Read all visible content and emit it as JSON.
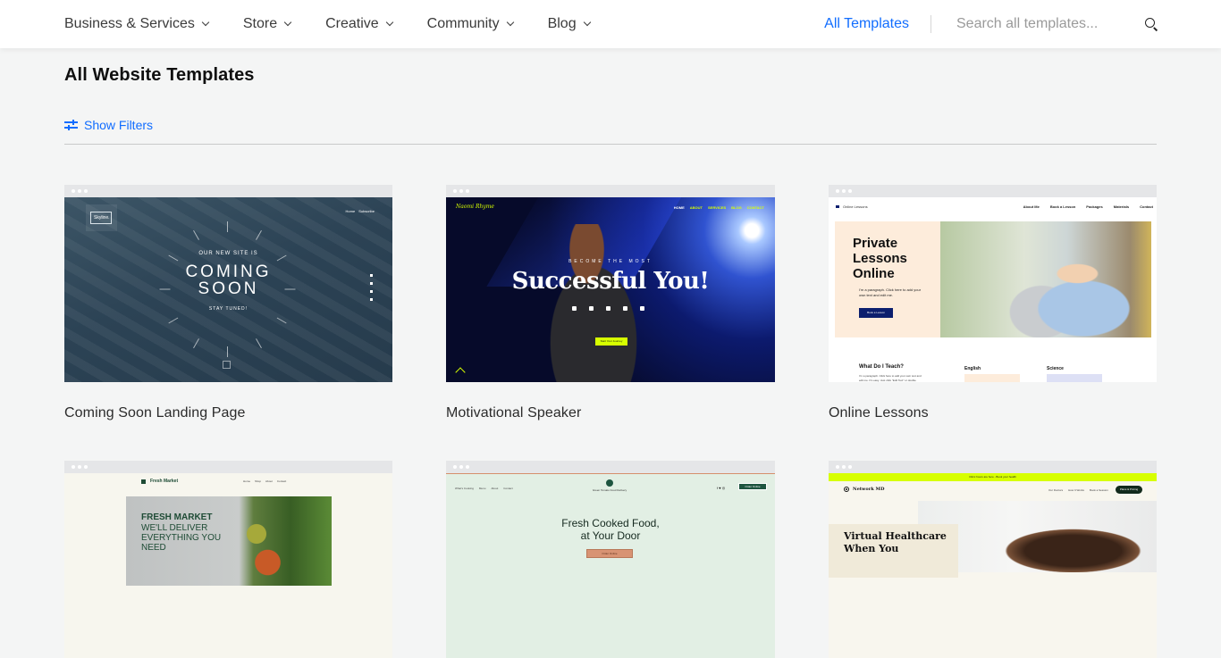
{
  "header": {
    "nav": [
      {
        "label": "Business & Services"
      },
      {
        "label": "Store"
      },
      {
        "label": "Creative"
      },
      {
        "label": "Community"
      },
      {
        "label": "Blog"
      }
    ],
    "all_templates": "All Templates",
    "search": {
      "placeholder": "Search all templates...",
      "value": ""
    },
    "accent_color": "#116dff"
  },
  "main": {
    "title": "All Website Templates",
    "filters_label": "Show Filters",
    "templates": [
      {
        "name": "Coming Soon Landing Page",
        "preview": {
          "brand": "Skyline.",
          "nav": [
            "Home",
            "Subscribe"
          ],
          "kicker": "OUR NEW SITE IS",
          "headline_1": "COMING",
          "headline_2": "SOON",
          "sub": "STAY TUNED!"
        }
      },
      {
        "name": "Motivational Speaker",
        "preview": {
          "brand": "Naomi Rhyme",
          "nav": [
            "HOME",
            "ABOUT",
            "SERVICES",
            "BLOG",
            "CONTACT"
          ],
          "kicker": "BECOME THE MOST",
          "headline": "Successful You!",
          "cta": "Start Your Journey"
        }
      },
      {
        "name": "Online Lessons",
        "preview": {
          "brand": "Online Lessons",
          "nav": [
            "About Me",
            "Book a Lesson",
            "Packages",
            "Materials",
            "Contact"
          ],
          "headline": "Private Lessons Online",
          "paragraph": "I'm a paragraph. Click here to add your own text and edit me.",
          "cta": "Book a Lesson",
          "section_title": "What Do I Teach?",
          "section_paragraph": "I'm a paragraph. Click here to add your own text and edit me. It's easy. Just click \"Edit Text\" or double click me to add your own content and make changes to the font.",
          "subjects": [
            "English",
            "Science"
          ]
        }
      },
      {
        "name": "",
        "preview": {
          "brand": "Fresh Market",
          "nav": [
            "Home",
            "Shop",
            "About",
            "Contact"
          ],
          "headline_1": "FRESH MARKET",
          "headline_2": "WE'LL DELIVER EVERYTHING YOU NEED"
        }
      },
      {
        "name": "",
        "preview": {
          "brand": "Green Tomato Food Delivery",
          "nav": [
            "What's Cooking",
            "Menu",
            "About",
            "Contact"
          ],
          "cta_top": "Order Online",
          "headline_1": "Fresh Cooked Food,",
          "headline_2": "at Your Door",
          "cta": "Order Online"
        }
      },
      {
        "name": "",
        "preview": {
          "banner": "Clinic hours are here - Book your health",
          "brand": "Network MD",
          "nav": [
            "Our Doctors",
            "How It Works",
            "Book a Session"
          ],
          "cta": "Plans & Pricing",
          "headline_1": "Virtual Healthcare",
          "headline_2": "When You"
        }
      }
    ]
  }
}
